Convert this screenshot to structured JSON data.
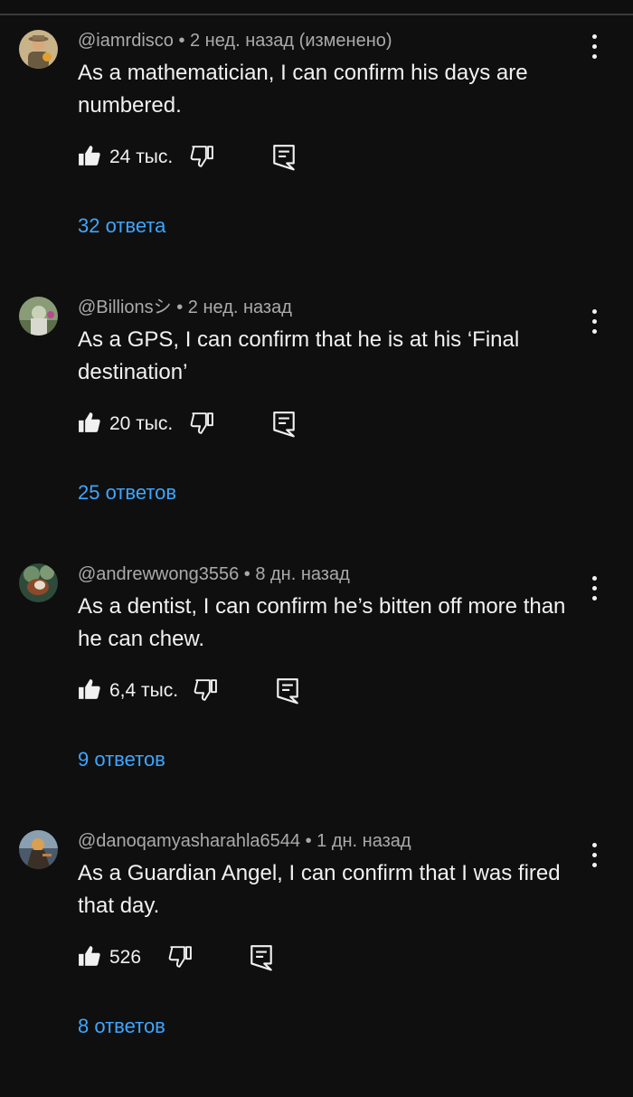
{
  "colors": {
    "background": "#0f0f0f",
    "text_primary": "#f1f1f1",
    "text_secondary": "#aaaaaa",
    "link": "#3ea6ff"
  },
  "icons": {
    "like": "thumb-up-icon",
    "dislike": "thumb-down-icon",
    "reply": "comment-reply-icon",
    "more": "vertical-dots-icon"
  },
  "comments": [
    {
      "author": "@iamrdisco",
      "meta_suffix": " • 2 нед. назад (изменено)",
      "text": "As a mathematician, I can confirm his days are numbered.",
      "likes": "24 тыс.",
      "replies": "32 ответа"
    },
    {
      "author": "@Billionsシ",
      "meta_suffix": " • 2 нед. назад",
      "text": "As a GPS, I can confirm that he is at his ‘Final destination’",
      "likes": "20 тыс.",
      "replies": "25 ответов"
    },
    {
      "author": "@andrewwong3556",
      "meta_suffix": " • 8 дн. назад",
      "text": "As a dentist, I can confirm he’s bitten off more than he can chew.",
      "likes": "6,4 тыс.",
      "replies": "9 ответов"
    },
    {
      "author": "@danoqamyasharahla6544",
      "meta_suffix": " • 1 дн. назад",
      "text": "As a Guardian Angel, I can confirm that I was fired that day.",
      "likes": "526",
      "replies": "8 ответов"
    }
  ]
}
